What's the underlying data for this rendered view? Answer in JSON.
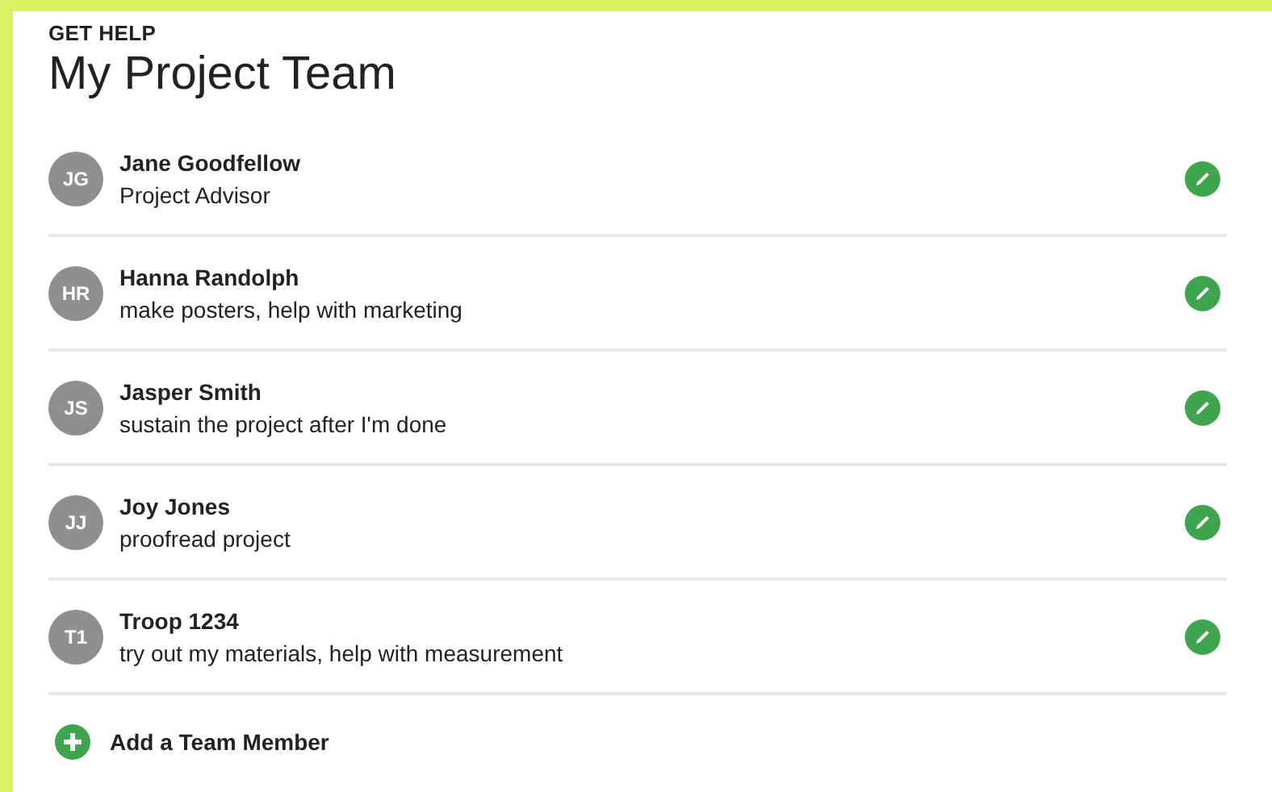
{
  "eyebrow": "GET HELP",
  "title": "My Project Team",
  "members": [
    {
      "initials": "JG",
      "name": "Jane Goodfellow",
      "role": "Project Advisor"
    },
    {
      "initials": "HR",
      "name": "Hanna Randolph",
      "role": "make posters, help with marketing"
    },
    {
      "initials": "JS",
      "name": "Jasper Smith",
      "role": "sustain the project after I'm done"
    },
    {
      "initials": "JJ",
      "name": "Joy Jones",
      "role": "proofread project"
    },
    {
      "initials": "T1",
      "name": "Troop 1234",
      "role": "try out my materials, help with measurement"
    }
  ],
  "add_button": "Add a Team Member"
}
